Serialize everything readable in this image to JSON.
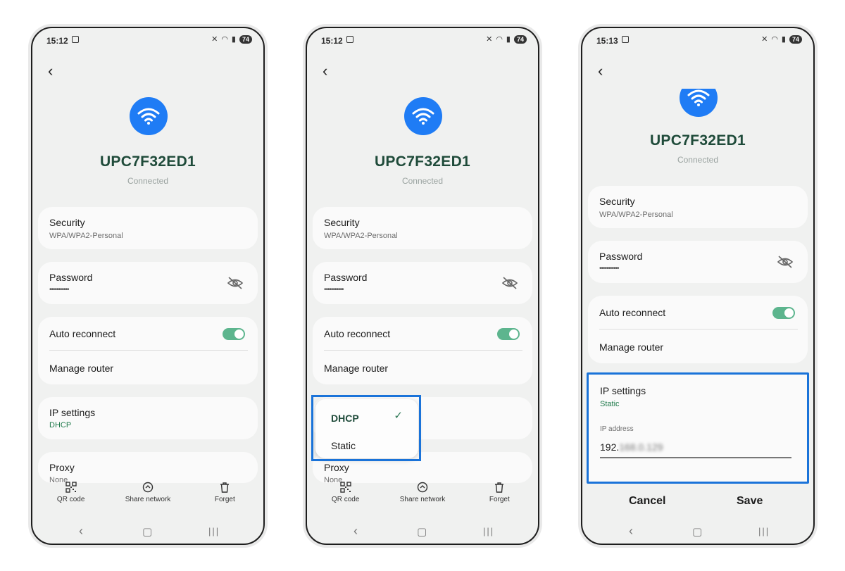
{
  "phones": [
    {
      "status": {
        "time": "15:12",
        "battery": "74"
      },
      "network": {
        "name": "UPC7F32ED1",
        "state": "Connected"
      },
      "security": {
        "label": "Security",
        "value": "WPA/WPA2-Personal"
      },
      "password": {
        "label": "Password",
        "value": "•••••••••••"
      },
      "auto_reconnect": {
        "label": "Auto reconnect"
      },
      "manage_router": {
        "label": "Manage router"
      },
      "ip_settings": {
        "label": "IP settings",
        "value": "DHCP"
      },
      "proxy": {
        "label": "Proxy",
        "value": "None"
      },
      "bottom": {
        "qr": "QR code",
        "share": "Share network",
        "forget": "Forget"
      }
    },
    {
      "status": {
        "time": "15:12",
        "battery": "74"
      },
      "network": {
        "name": "UPC7F32ED1",
        "state": "Connected"
      },
      "security": {
        "label": "Security",
        "value": "WPA/WPA2-Personal"
      },
      "password": {
        "label": "Password",
        "value": "•••••••••••"
      },
      "auto_reconnect": {
        "label": "Auto reconnect"
      },
      "manage_router": {
        "label": "Manage router"
      },
      "dropdown": {
        "options": [
          "DHCP",
          "Static"
        ],
        "selected": "DHCP"
      },
      "proxy": {
        "label": "Proxy",
        "value": "None"
      },
      "bottom": {
        "qr": "QR code",
        "share": "Share network",
        "forget": "Forget"
      }
    },
    {
      "status": {
        "time": "15:13",
        "battery": "74"
      },
      "network": {
        "name": "UPC7F32ED1",
        "state": "Connected"
      },
      "security": {
        "label": "Security",
        "value": "WPA/WPA2-Personal"
      },
      "password": {
        "label": "Password",
        "value": "•••••••••••"
      },
      "auto_reconnect": {
        "label": "Auto reconnect"
      },
      "manage_router": {
        "label": "Manage router"
      },
      "ip_settings": {
        "label": "IP settings",
        "value": "Static"
      },
      "ip_address": {
        "label": "IP address",
        "value_prefix": "192.",
        "value_blurred": "168.0.129"
      },
      "dialog": {
        "cancel": "Cancel",
        "save": "Save"
      }
    }
  ],
  "colors": {
    "accent_blue": "#1a73d9",
    "toggle_green": "#5db58e",
    "title_green": "#1f4b3a"
  }
}
